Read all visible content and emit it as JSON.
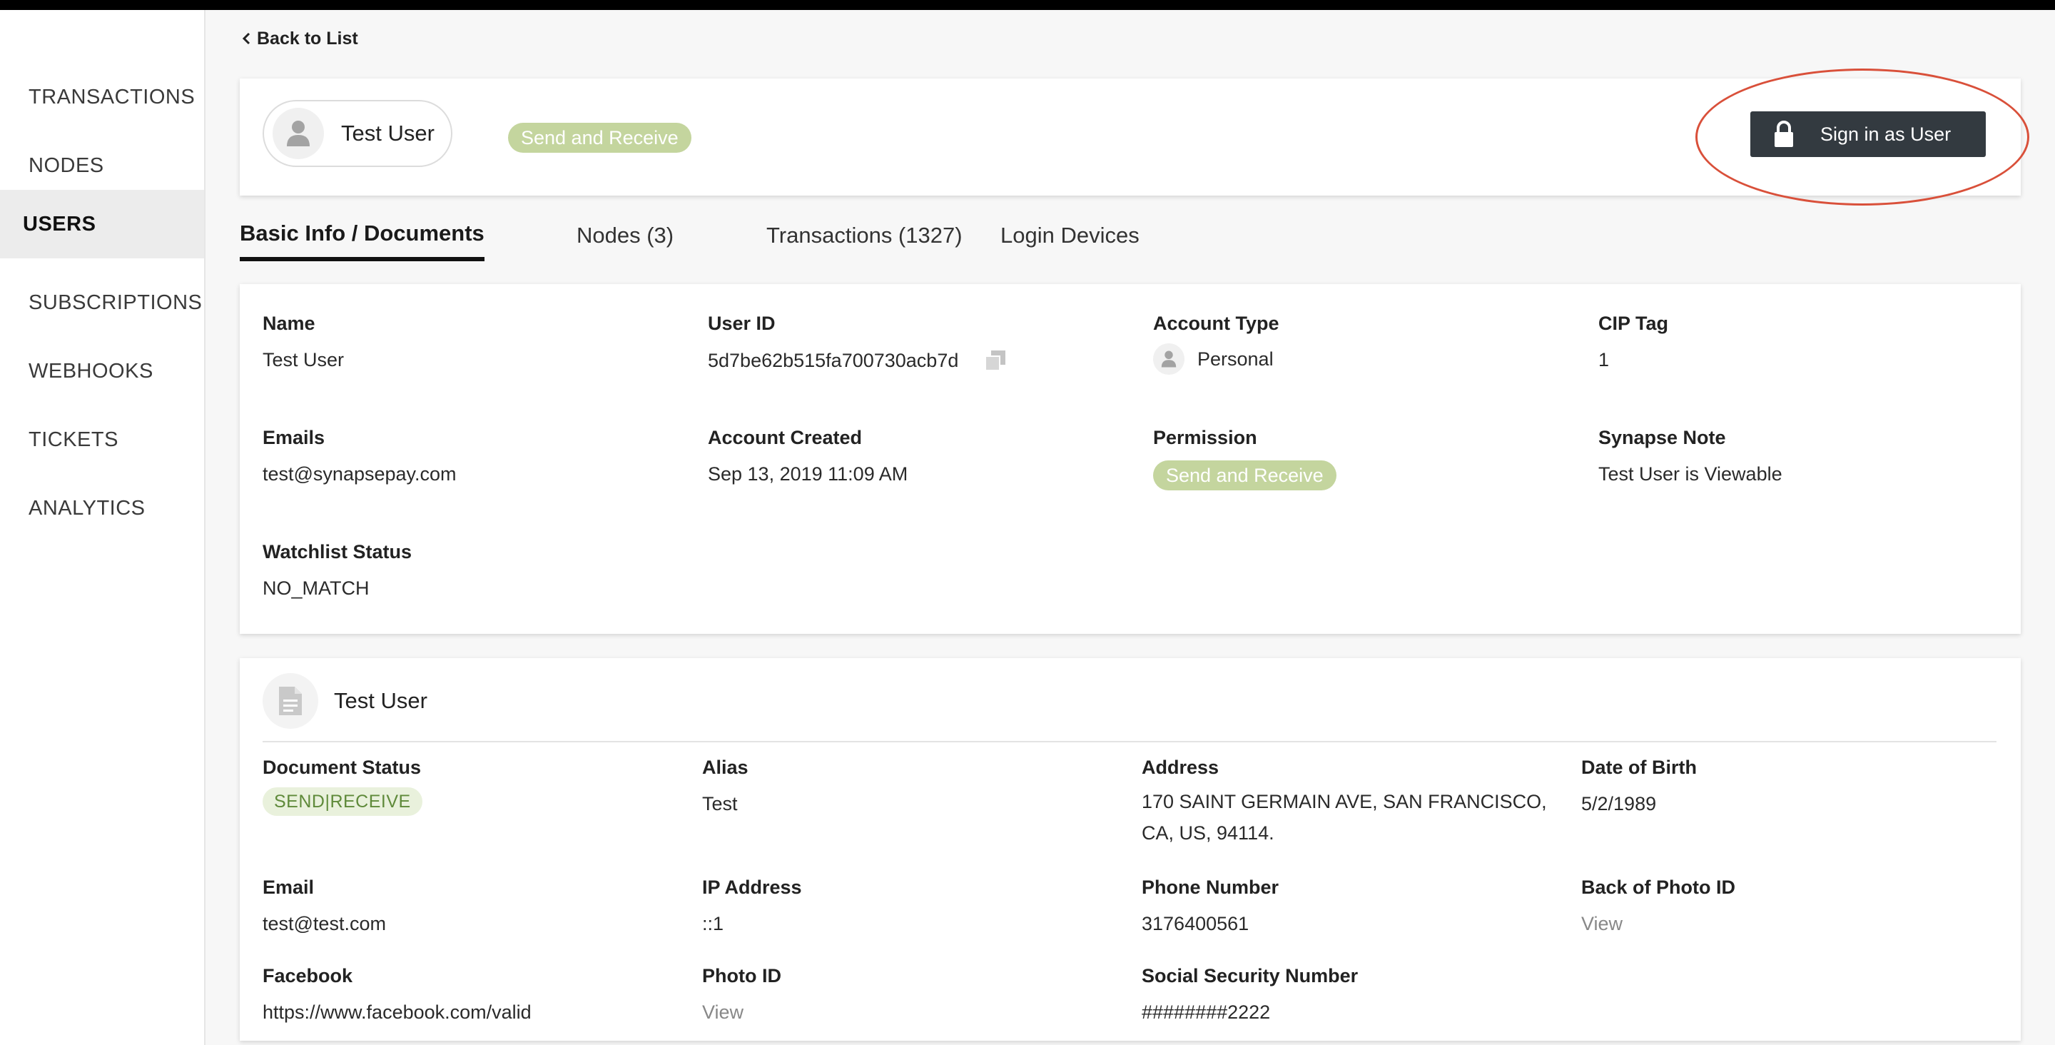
{
  "sidebar": {
    "items": [
      {
        "label": "TRANSACTIONS"
      },
      {
        "label": "NODES"
      },
      {
        "label": "USERS"
      },
      {
        "label": "SUBSCRIPTIONS"
      },
      {
        "label": "WEBHOOKS"
      },
      {
        "label": "TICKETS"
      },
      {
        "label": "ANALYTICS"
      }
    ],
    "active": "USERS"
  },
  "header": {
    "back_label": "Back to List",
    "user_name": "Test User",
    "permission_badge": "Send and Receive",
    "signin_label": "Sign in as User",
    "highlight_color": "#d9503a"
  },
  "tabs": [
    {
      "label": "Basic Info / Documents",
      "active": true
    },
    {
      "label": "Nodes (3)"
    },
    {
      "label": "Transactions (1327)"
    },
    {
      "label": "Login Devices"
    }
  ],
  "basic_info": {
    "name": {
      "label": "Name",
      "value": "Test User"
    },
    "user_id": {
      "label": "User ID",
      "value": "5d7be62b515fa700730acb7d"
    },
    "account_type": {
      "label": "Account Type",
      "value": "Personal"
    },
    "cip_tag": {
      "label": "CIP Tag",
      "value": "1"
    },
    "emails": {
      "label": "Emails",
      "value": "test@synapsepay.com"
    },
    "account_created": {
      "label": "Account Created",
      "value": "Sep 13, 2019 11:09 AM"
    },
    "permission": {
      "label": "Permission",
      "value": "Send and Receive"
    },
    "synapse_note": {
      "label": "Synapse Note",
      "value": "Test User is Viewable"
    },
    "watchlist": {
      "label": "Watchlist Status",
      "value": "NO_MATCH"
    }
  },
  "document": {
    "title": "Test User",
    "document_status": {
      "label": "Document Status",
      "value": "SEND|RECEIVE"
    },
    "alias": {
      "label": "Alias",
      "value": "Test"
    },
    "address": {
      "label": "Address",
      "value": "170 SAINT GERMAIN AVE, SAN FRANCISCO, CA, US, 94114."
    },
    "dob": {
      "label": "Date of Birth",
      "value": "5/2/1989"
    },
    "email": {
      "label": "Email",
      "value": "test@test.com"
    },
    "ip": {
      "label": "IP Address",
      "value": "::1"
    },
    "phone": {
      "label": "Phone Number",
      "value": "3176400561"
    },
    "back_photo_id": {
      "label": "Back of Photo ID",
      "value": "View"
    },
    "facebook": {
      "label": "Facebook",
      "value": "https://www.facebook.com/valid"
    },
    "photo_id": {
      "label": "Photo ID",
      "value": "View"
    },
    "ssn": {
      "label": "Social Security Number",
      "value": "########2222"
    }
  },
  "colors": {
    "accent_green": "#c4d59e",
    "button_dark": "#333a40",
    "status_green_text": "#5f8a3a"
  }
}
